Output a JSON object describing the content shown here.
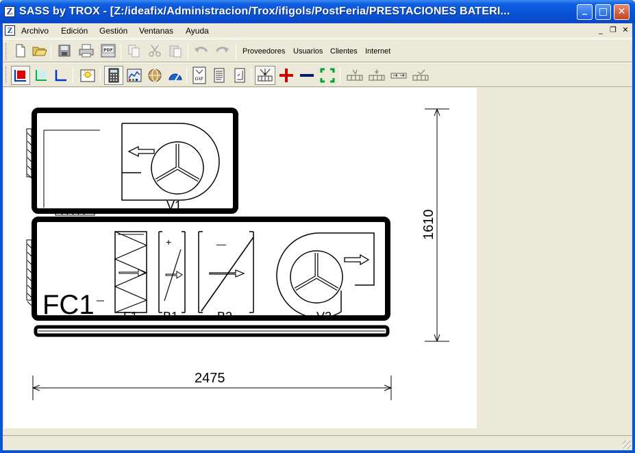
{
  "window": {
    "title": "SASS by TROX - [Z:/ideafix/Administracion/Trox/ifigols/PostFeria/PRESTACIONES BATERI...",
    "app_icon_letter": "Z",
    "minimize_glyph": "_",
    "maximize_glyph": "□",
    "close_glyph": "✕"
  },
  "menubar": {
    "items": [
      "Archivo",
      "Edición",
      "Gestión",
      "Ventanas",
      "Ayuda"
    ],
    "mdi_minimize": "_",
    "mdi_restore": "❐",
    "mdi_close": "✕"
  },
  "toolbar1": {
    "buttons": [
      "new-document-icon",
      "open-folder-icon",
      "save-icon",
      "print-icon",
      "pdf-icon",
      "copy-icon",
      "cut-icon",
      "paste-icon",
      "undo-icon",
      "redo-icon"
    ],
    "links": [
      "Proveedores",
      "Usuarios",
      "Clientes",
      "Internet"
    ]
  },
  "toolbar2": {
    "buttons": [
      "red-square-icon",
      "axis-view-icon",
      "blue-corner-icon",
      "lightbulb-icon",
      "calculator-icon",
      "chart-icon",
      "globe-icon",
      "gauge-icon",
      "dxf-export-icon",
      "report-icon",
      "dimension-icon",
      "light-section-icon",
      "add-red-icon",
      "remove-navy-icon",
      "fit-green-icon",
      "section-a-icon",
      "section-b-icon",
      "section-c-icon",
      "section-d-icon"
    ],
    "dxf_label": "DXF"
  },
  "drawing": {
    "unit_label": "FC1",
    "width_dimension": "2475",
    "height_dimension": "1610",
    "components": {
      "upper_fan": "V1",
      "filter": "F1",
      "heating_coil": "B1",
      "cooling_coil": "B2",
      "lower_fan": "V2"
    },
    "heating_sign": "+",
    "cooling_sign": "—"
  }
}
